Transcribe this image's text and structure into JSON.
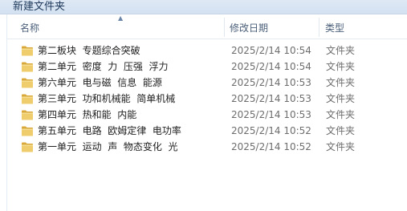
{
  "window": {
    "top_label": "新建文件夹"
  },
  "columns": {
    "name": "名称",
    "date": "修改日期",
    "type": "类型",
    "sort_icon": "sort-ascending-icon"
  },
  "rows": [
    {
      "name": "第二板块  专题综合突破",
      "date": "2025/2/14 10:54",
      "type": "文件夹",
      "icon": "folder-icon"
    },
    {
      "name": "第二单元  密度  力  压强  浮力",
      "date": "2025/2/14 10:54",
      "type": "文件夹",
      "icon": "folder-icon"
    },
    {
      "name": "第六单元  电与磁  信息  能源",
      "date": "2025/2/14 10:53",
      "type": "文件夹",
      "icon": "folder-icon"
    },
    {
      "name": "第三单元  功和机械能  简单机械",
      "date": "2025/2/14 10:53",
      "type": "文件夹",
      "icon": "folder-icon"
    },
    {
      "name": "第四单元  热和能  内能",
      "date": "2025/2/14 10:53",
      "type": "文件夹",
      "icon": "folder-icon"
    },
    {
      "name": "第五单元  电路  欧姆定律  电功率",
      "date": "2025/2/14 10:52",
      "type": "文件夹",
      "icon": "folder-icon"
    },
    {
      "name": "第一单元  运动  声  物态变化  光",
      "date": "2025/2/14 10:52",
      "type": "文件夹",
      "icon": "folder-icon"
    }
  ],
  "colors": {
    "folder_body": "#e8c15a",
    "folder_tab": "#d9a83a",
    "header_text": "#4c607a"
  }
}
